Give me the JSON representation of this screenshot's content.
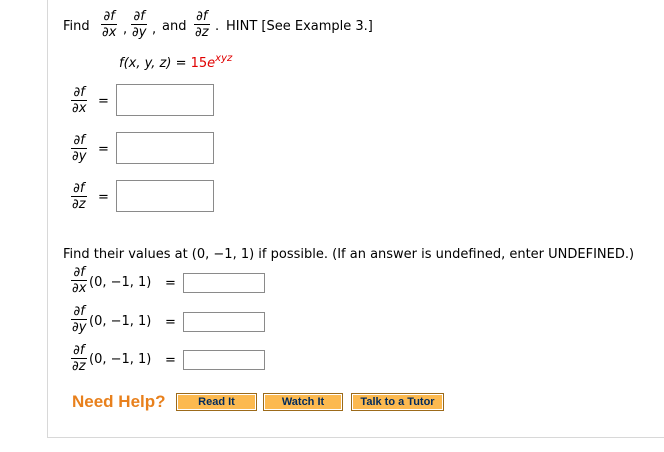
{
  "question": {
    "find_label": "Find",
    "partial_num": "∂f",
    "den_x": "∂x",
    "den_y": "∂y",
    "den_z": "∂z",
    "comma": ",",
    "and_label": "and",
    "period": ".",
    "hint": "HINT [See Example 3.]",
    "function_lhs": "f(x, y, z) =",
    "function_coef": "15",
    "function_base": "e",
    "function_exp": "xyz",
    "equals": "="
  },
  "evaluate": {
    "instruction": "Find their values at (0, −1, 1) if possible. (If an answer is undefined, enter UNDEFINED.)",
    "point": "(0, −1, 1)",
    "equals": "="
  },
  "help": {
    "label": "Need Help?",
    "buttons": [
      "Read It",
      "Watch It",
      "Talk to a Tutor"
    ]
  },
  "colors": {
    "accent_red": "#e00000",
    "help_orange": "#e8801c",
    "button_fill": "#fcb94f",
    "button_text": "#002a5c"
  }
}
